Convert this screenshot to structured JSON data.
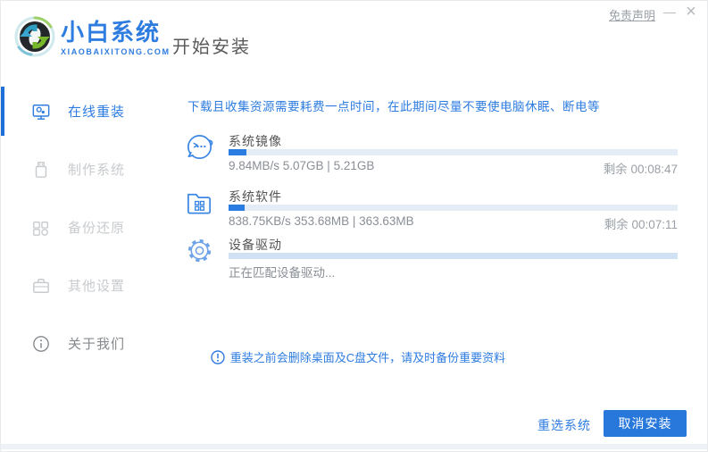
{
  "header": {
    "logo_title": "小白系统",
    "logo_subtitle": "XIAOBAIXITONG.COM",
    "page_title": "开始安装",
    "disclaimer_link": "免责声明",
    "minimize_glyph": "—",
    "close_glyph": "×"
  },
  "sidebar": {
    "items": [
      {
        "label": "在线重装",
        "icon": "online-reinstall-monitor-icon",
        "active": true
      },
      {
        "label": "制作系统",
        "icon": "make-system-usb-icon",
        "active": false
      },
      {
        "label": "备份还原",
        "icon": "backup-restore-squares-icon",
        "active": false
      },
      {
        "label": "其他设置",
        "icon": "other-settings-briefcase-icon",
        "active": false
      },
      {
        "label": "关于我们",
        "icon": "about-us-info-icon",
        "active": false
      }
    ]
  },
  "main": {
    "notice": "下载且收集资源需要耗费一点时间，在此期间尽量不要使电脑休眠、断电等",
    "tasks": [
      {
        "title": "系统镜像",
        "icon": "mascot-face-icon",
        "stats": "9.84MB/s 5.07GB | 5.21GB",
        "remaining": "剩余 00:08:47",
        "progress_percent": 4,
        "indeterminate": false
      },
      {
        "title": "系统软件",
        "icon": "software-folder-icon",
        "stats": "838.75KB/s 353.68MB | 363.63MB",
        "remaining": "剩余 00:07:11",
        "progress_percent": 3.5,
        "indeterminate": false
      },
      {
        "title": "设备驱动",
        "icon": "driver-gear-icon",
        "stats": "正在匹配设备驱动...",
        "remaining": "",
        "progress_percent": 0,
        "indeterminate": true
      }
    ],
    "warning": "重装之前会删除桌面及C盘文件，请及时备份重要资料"
  },
  "footer": {
    "reselect_label": "重选系统",
    "cancel_label": "取消安装"
  },
  "colors": {
    "brand_blue": "#2e7ce0",
    "button_blue": "#2878dc",
    "progress_fill": "#2b7ce0",
    "progress_track": "#e4ecf6",
    "progress_indeterminate": "#cfe1f3",
    "sidebar_active_bar": "#1f6fd8",
    "inactive_gray": "#c8cbce",
    "text_dark": "#555555",
    "text_gray": "#8a8f96",
    "bottom_strip": "#eef1f6"
  }
}
